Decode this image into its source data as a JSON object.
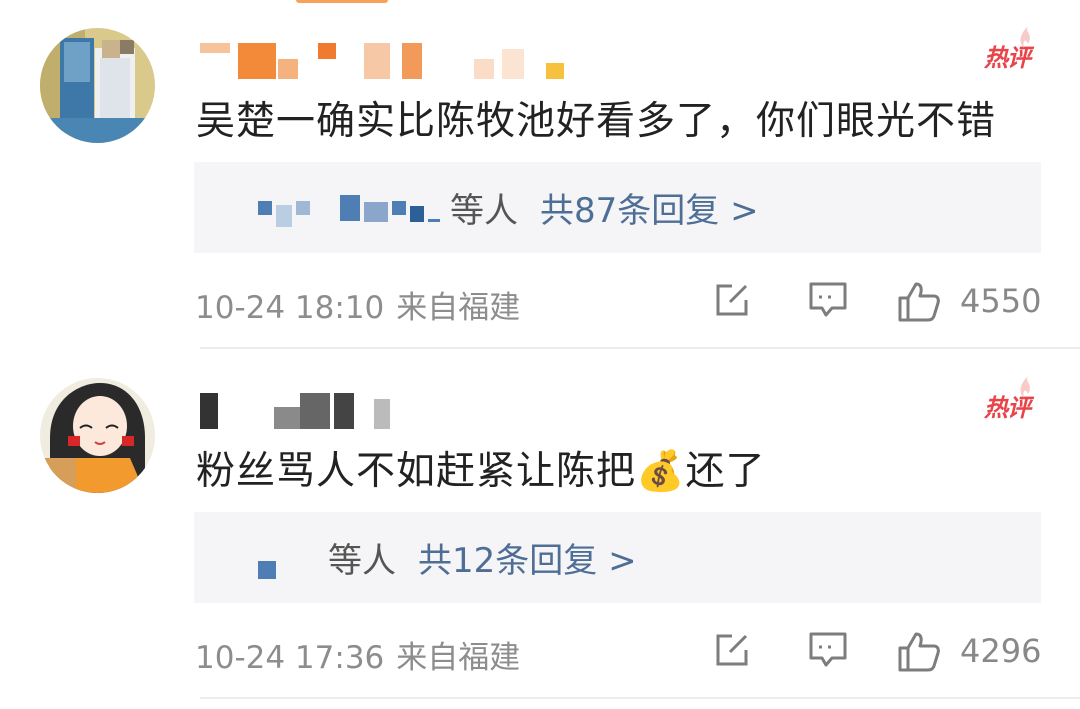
{
  "comments": [
    {
      "hot_badge": "热评",
      "text": "吴楚一确实比陈牧池好看多了，你们眼光不错",
      "reply": {
        "names": "等人",
        "count_label": "共87条回复 >"
      },
      "meta": {
        "time": "10-24 18:10",
        "source": "来自福建"
      },
      "likes": "4550"
    },
    {
      "hot_badge": "热评",
      "text": "粉丝骂人不如赶紧让陈把💰还了",
      "reply": {
        "names": "等人",
        "count_label": "共12条回复 >"
      },
      "meta": {
        "time": "10-24 17:36",
        "source": "来自福建"
      },
      "likes": "4296"
    }
  ],
  "icons": {
    "share": "share-icon",
    "comment": "comment-icon",
    "like": "thumbs-up-icon",
    "flame": "flame-icon"
  },
  "colors": {
    "hot": "#e8444a",
    "link": "#4e6e96",
    "meta": "#8d8d8d",
    "reply_bg": "#f5f5f7"
  }
}
